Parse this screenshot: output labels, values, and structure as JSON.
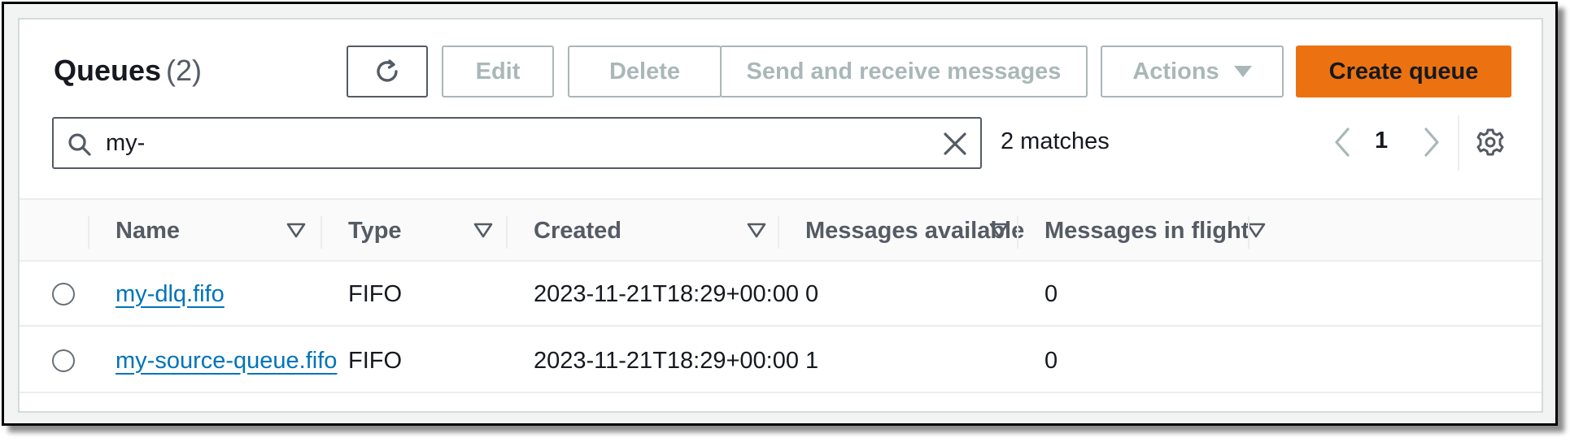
{
  "header": {
    "title": "Queues",
    "count": "(2)"
  },
  "toolbar": {
    "refresh_icon": "refresh-icon",
    "edit_label": "Edit",
    "delete_label": "Delete",
    "send_label": "Send and receive messages",
    "actions_label": "Actions",
    "create_label": "Create queue"
  },
  "search": {
    "value": "my-",
    "matches": "2 matches"
  },
  "pagination": {
    "current_page": "1"
  },
  "table": {
    "columns": [
      "Name",
      "Type",
      "Created",
      "Messages available",
      "Messages in flight"
    ],
    "rows": [
      {
        "name": "my-dlq.fifo",
        "type": "FIFO",
        "created": "2023-11-21T18:29+00:00",
        "available": "0",
        "in_flight": "0"
      },
      {
        "name": "my-source-queue.fifo",
        "type": "FIFO",
        "created": "2023-11-21T18:29+00:00",
        "available": "1",
        "in_flight": "0"
      }
    ]
  },
  "colors": {
    "primary_button": "#ec7211",
    "link": "#0073bb",
    "disabled_text": "#aab7b8"
  }
}
